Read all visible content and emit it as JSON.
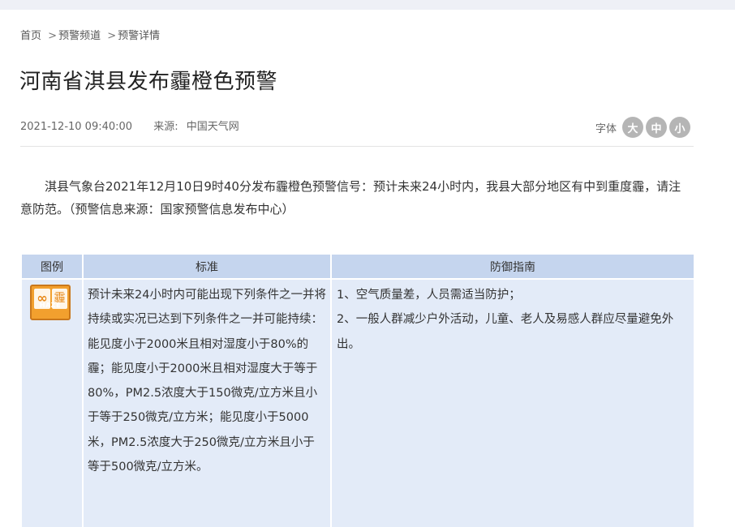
{
  "breadcrumb": {
    "home": "首页",
    "sep1": ">",
    "channel": "预警频道",
    "sep2": ">",
    "detail": "预警详情"
  },
  "article": {
    "title": "河南省淇县发布霾橙色预警",
    "datetime": "2021-12-10 09:40:00",
    "source_label": "来源:",
    "source_value": "中国天气网",
    "body": "淇县气象台2021年12月10日9时40分发布霾橙色预警信号：预计未来24小时内，我县大部分地区有中到重度霾，请注意防范。（预警信息来源：国家预警信息发布中心）"
  },
  "font_size": {
    "label": "字体",
    "large": "大",
    "medium": "中",
    "small": "小"
  },
  "table": {
    "headers": [
      "图例",
      "标准",
      "防御指南"
    ],
    "icon": {
      "name": "haze-orange-warning-icon",
      "left_glyph": "∞",
      "right_glyph": "霾",
      "code": "HAZE",
      "color": "#f2a02e"
    },
    "standard": "预计未来24小时内可能出现下列条件之一并将持续或实况已达到下列条件之一并可能持续：能见度小于2000米且相对湿度小于80%的霾；能见度小于2000米且相对湿度大于等于80%，PM2.5浓度大于150微克/立方米且小于等于250微克/立方米；能见度小于5000米，PM2.5浓度大于250微克/立方米且小于等于500微克/立方米。",
    "guide": [
      "1、空气质量差，人员需适当防护；",
      "2、一般人群减少户外活动，儿童、老人及易感人群应尽量避免外出。"
    ]
  },
  "colors": {
    "header_bg": "#c5d5ee",
    "cell_bg": "#e3ebf8",
    "font_btn": "#b5b5b5"
  }
}
